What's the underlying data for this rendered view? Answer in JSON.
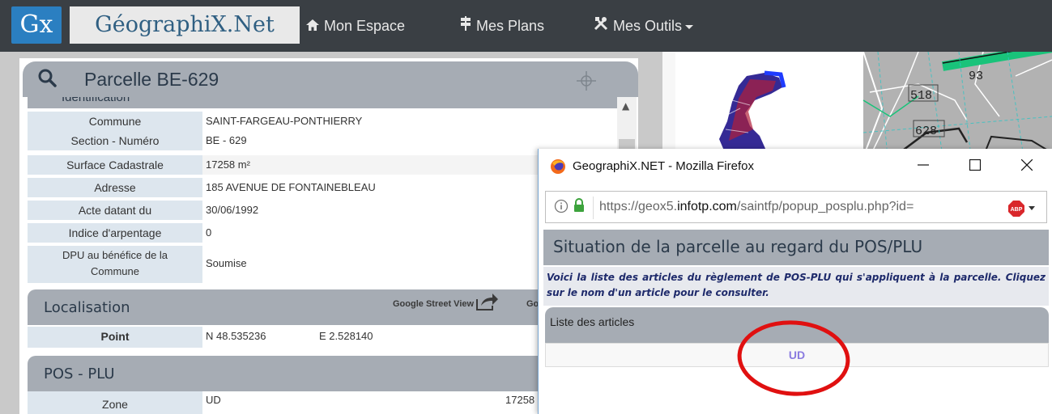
{
  "navbar": {
    "logo_short": "Gx",
    "logo_name": "GéographiX.Net",
    "items": [
      {
        "label": "Mon Espace",
        "icon": "home-icon"
      },
      {
        "label": "Mes Plans",
        "icon": "plans-icon"
      },
      {
        "label": "Mes Outils",
        "icon": "tools-icon"
      }
    ]
  },
  "panel": {
    "title": "Parcelle BE-629",
    "identification_label": "Identification",
    "rows": [
      {
        "label": "Commune",
        "value": "SAINT-FARGEAU-PONTHIERRY"
      },
      {
        "label": "Section - Numéro",
        "value": "BE - 629"
      },
      {
        "label": "Surface Cadastrale",
        "value": "17258 m²"
      },
      {
        "label": "Adresse",
        "value": "185 AVENUE DE FONTAINEBLEAU"
      },
      {
        "label": "Acte datant du",
        "value": "30/06/1992"
      },
      {
        "label": "Indice d'arpentage",
        "value": "0"
      },
      {
        "label": "DPU au bénéfice de la Commune",
        "value": "Soumise"
      }
    ],
    "localisation": {
      "title": "Localisation",
      "street_view_label": "Google Street View",
      "second_link_label": "Go",
      "point_label": "Point",
      "lat": "N 48.535236",
      "lon": "E 2.528140"
    },
    "pos_plu": {
      "title": "POS - PLU",
      "zone_label": "Zone",
      "zone_value": "UD",
      "zone_surface": "17258"
    }
  },
  "map": {
    "parcel_labels": [
      "93",
      "518",
      "628"
    ]
  },
  "popup": {
    "window_title": "GeographiX.NET - Mozilla Firefox",
    "url_prefix": "https://geox5.",
    "url_domain": "infotp.com",
    "url_suffix": "/saintfp/popup_posplu.php?id=",
    "heading": "Situation de la parcelle au regard du POS/PLU",
    "note": "Voici la liste des articles du règlement de POS-PLU qui s'appliquent à la parcelle. Cliquez sur le nom d'un article pour le consulter.",
    "list_header": "Liste des articles",
    "articles": [
      "UD"
    ]
  },
  "colors": {
    "navbar": "#3a3f44",
    "section_header": "#a6acb4",
    "label_bg": "#dde6ee",
    "link": "#8a7be0",
    "highlight": "#e01010"
  }
}
